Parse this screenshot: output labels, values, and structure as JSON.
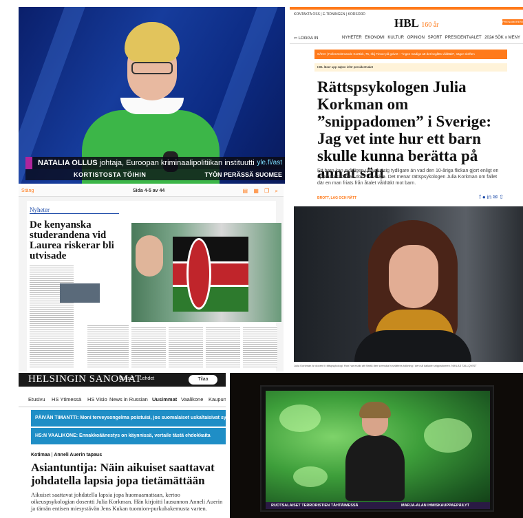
{
  "tv1": {
    "name": "NATALIA OLLUS",
    "title": "johtaja, Euroopan kriminaalipolitiikan instituutti",
    "site": "yle.fi/ast",
    "bottom_left": "KORTISTOSTA TÖIHIN",
    "bottom_right": "TYÖN PERÄSSÄ SUOMEE"
  },
  "hbl": {
    "topline": "KONTAKTA OSS | E-TIDNINGEN | KORSORD",
    "logo": "HBL",
    "logo_sub": "160 år",
    "subscribe": "PRENUMERERA",
    "login": "LOGGA IN",
    "nav": [
      "NYHETER",
      "EKONOMI",
      "KULTUR",
      "OPINION",
      "SPORT",
      "PRESIDENTVALET 2024"
    ],
    "search": "SÖK",
    "menu": "MENY",
    "alert": "SÄKO | Folkmördömande Korttisk, 75, Ilkij Finner på golvet – \"ingen madige att det begåtts våldtäkt\", säger skriften",
    "teaser": "HBL läser upp sajten inför presidentvalet",
    "headline": "Rättspsykologen Julia Korkman om ”snippadomen” i Sverige: Jag vet inte hur ett barn skulle kunna berätta på annat sätt",
    "lede": "Ett barn kan svårligen uttrycka sig tydligare än vad den 10-åriga flickan gjort enligt en uppmärksammad dom i Sverige. Det menar rättspsykologen Julia Korkman om fallet där en man friats från åtalet våldtäkt mot barn.",
    "tag": "BROTT, LAG OCH RÄTT",
    "caption": "Julia Korkman är docent i rättspsykologi. Hon har exakt att förstå den svenska hovrättens tolkning i den så kallade snippadomen. NIKLAS TALLQVIST"
  },
  "epaper": {
    "close": "Stäng",
    "pager": "Sida 4-5 av 44",
    "section": "Nyheter",
    "headline": "De kenyanska studerandena vid Laurea riskerar bli utvisade"
  },
  "hs": {
    "brand": "HELSINGIN SANOMAT",
    "links": [
      "Uutiset",
      "Lehdet"
    ],
    "order": "Tilaa",
    "tabs": [
      "Etusivu",
      "HS Ytimessä",
      "HS Visio",
      "News in Russian",
      "Uusimmat",
      "Vaalikone",
      "Kaupunk"
    ],
    "bar1": "PÄIVÄN TIMANTTI: Moni terveysongelma poistuisi, jos suomalaiset uskaltaisivat syödä en",
    "bar2": "HS:N VAALIKONE: Ennakkoäänestys on käynnissä, vertaile tästä ehdokkaita",
    "kicker_section": "Kotimaa",
    "kicker_topic": "Anneli Auerin tapaus",
    "headline": "Asiantuntija: Näin aikuiset saattavat johdatella lapsia jopa tietämättään",
    "lede": "Aikuiset saattavat johdatella lapsia jopa huomaamattaan, kertoo oikeuspsykologian dosentti Julia Korkman. Hän kirjoitti lausunnon Anneli Auerin ja tämän entisen miesystävän Jens Kukan tuomion-purkuhakemusta varten."
  },
  "tv2": {
    "ticker_left": "RUOTSALAISET TERRORISTIEN TÄHTÄIMESSÄ",
    "ticker_right": "MARJA-ALAN IHMISKAUPPAEPÄILYT"
  }
}
